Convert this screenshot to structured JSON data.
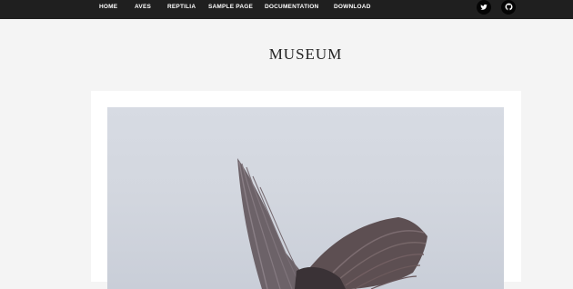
{
  "nav": {
    "items": [
      {
        "label": "HOME"
      },
      {
        "label": "AVES"
      },
      {
        "label": "REPTILIA"
      },
      {
        "label": "SAMPLE PAGE"
      },
      {
        "label": "DOCUMENTATION"
      },
      {
        "label": "DOWNLOAD"
      }
    ]
  },
  "social": {
    "twitter_icon": "twitter-icon",
    "github_icon": "github-icon"
  },
  "site": {
    "title": "MUSEUM"
  },
  "post": {
    "image_subject": "bird-in-flight-photo"
  },
  "colors": {
    "topbar": "#1f1f1f",
    "background": "#f4f4f4",
    "card": "#ffffff",
    "title": "#222222"
  }
}
